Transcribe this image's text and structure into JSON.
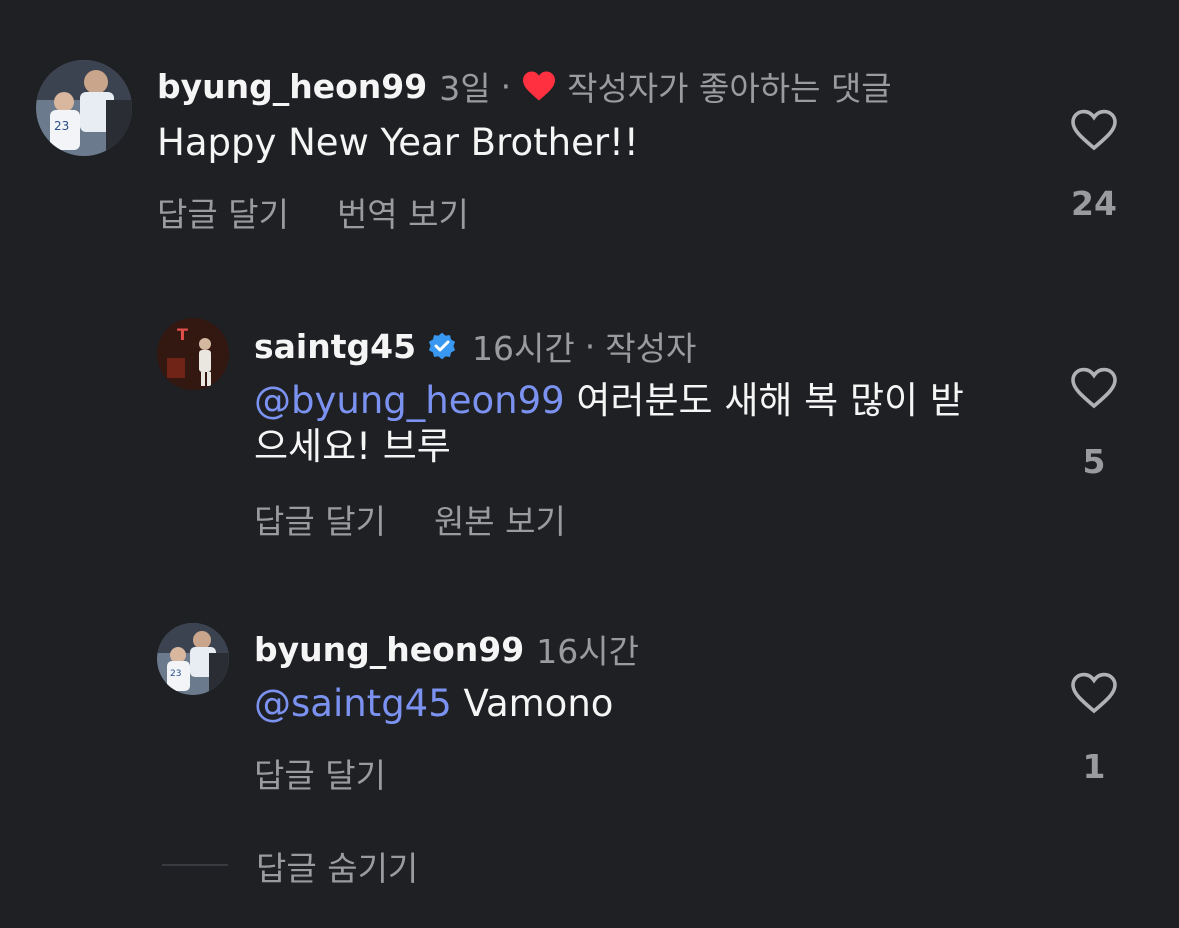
{
  "comments": [
    {
      "username": "byung_heon99",
      "time": "3일",
      "separator": "·",
      "creator_liked": "작성자가 좋아하는 댓글",
      "text": "Happy New Year Brother!!",
      "reply_label": "답글 달기",
      "translate_label": "번역 보기",
      "likes": "24"
    },
    {
      "username": "saintg45",
      "time": "16시간",
      "separator": "·",
      "author_badge": "작성자",
      "mention": "@byung_heon99",
      "text_line1": " 여러분도 새해 복 많이 받",
      "text_line2": "으세요! 브루",
      "reply_label": "답글 달기",
      "original_label": "원본 보기",
      "likes": "5"
    },
    {
      "username": "byung_heon99",
      "time": "16시간",
      "mention": "@saintg45",
      "text": " Vamono",
      "reply_label": "답글 달기",
      "likes": "1"
    }
  ],
  "hide_replies_label": "답글 숨기기",
  "colors": {
    "background": "#1f2024",
    "text": "#f5f5f5",
    "secondary": "#9a9b9f",
    "mention": "#7b92f0",
    "heart": "#ff3040",
    "verified": "#3897f0"
  },
  "icons": [
    "heart-outline-icon",
    "heart-filled-icon",
    "verified-badge-icon"
  ]
}
